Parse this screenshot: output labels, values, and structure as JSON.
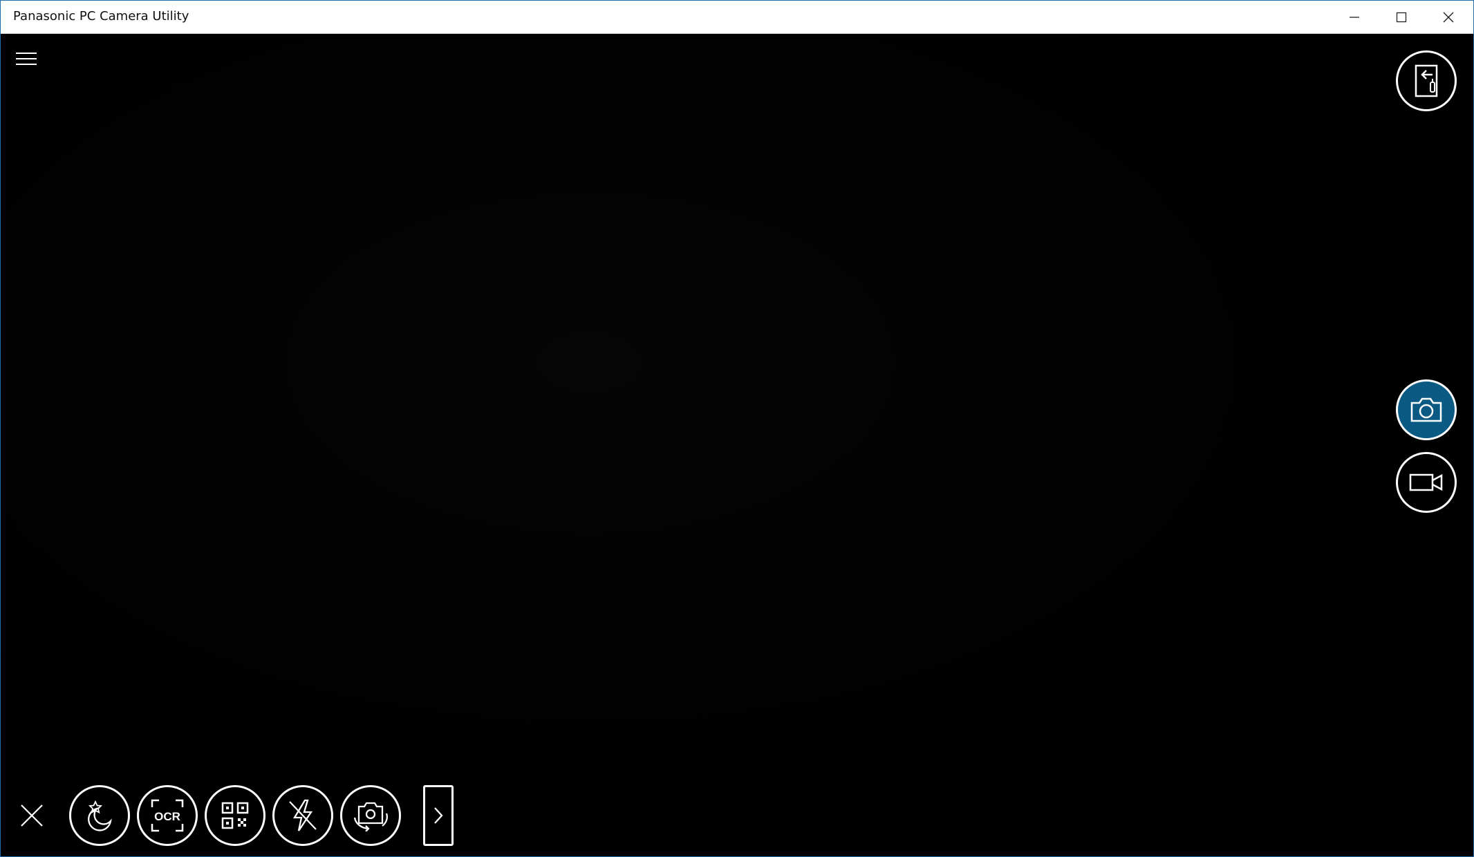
{
  "window": {
    "title": "Panasonic PC Camera Utility",
    "border_color": "#1f6fb0"
  },
  "titlebar_buttons": {
    "minimize_icon": "minimize-icon",
    "maximize_icon": "maximize-icon",
    "close_icon": "close-icon"
  },
  "toolbar": {
    "menu_icon": "hamburger-icon",
    "exit_icon": "exit-panel-icon",
    "photo_icon": "camera-icon",
    "video_icon": "video-camera-icon",
    "active_accent": "#0a5a84"
  },
  "bottom_bar": {
    "close_icon": "close-icon",
    "buttons": [
      {
        "name": "night-mode",
        "icon": "moon-star-icon"
      },
      {
        "name": "ocr",
        "icon": "ocr-icon",
        "label": "OCR"
      },
      {
        "name": "qr-code",
        "icon": "qr-code-icon"
      },
      {
        "name": "flash-off",
        "icon": "flash-off-icon"
      },
      {
        "name": "switch-camera",
        "icon": "switch-camera-icon"
      }
    ],
    "more_icon": "chevron-right-icon"
  }
}
